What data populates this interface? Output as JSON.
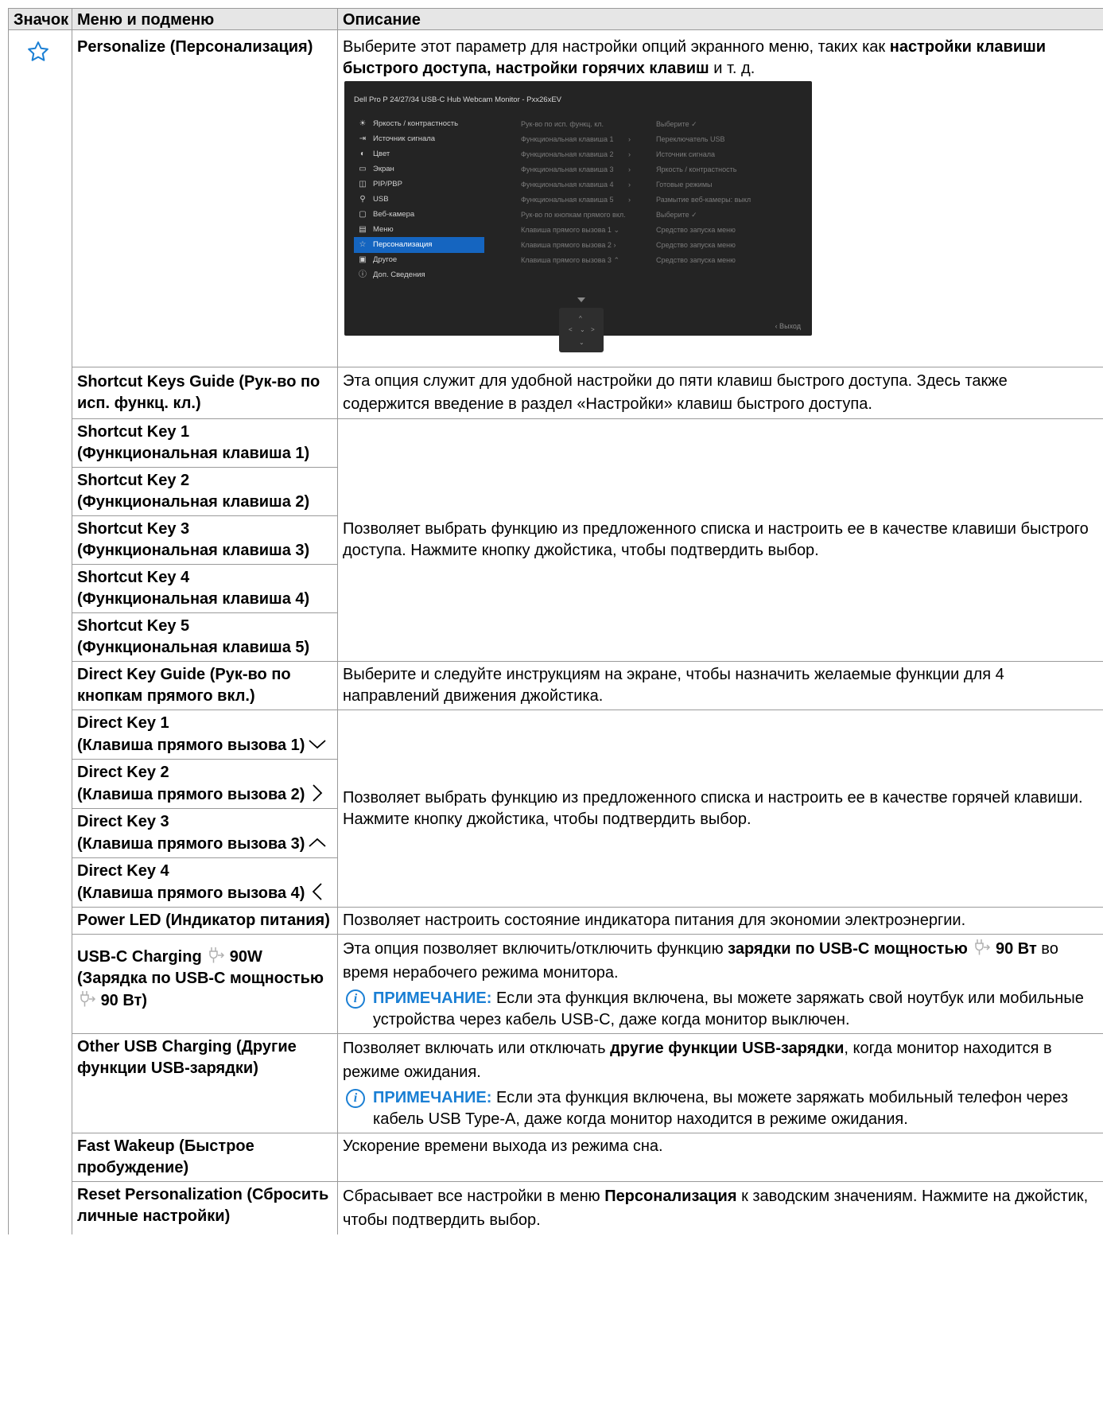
{
  "header": {
    "col_icon": "Значок",
    "col_menu": "Меню и подменю",
    "col_desc": "Описание"
  },
  "personalize": {
    "menu": "Personalize (Персонализация)",
    "desc_pre": "Выберите этот параметр для настройки опций экранного меню, таких как ",
    "desc_bold": "настройки клавиши быстрого доступа, настройки горячих клавиш",
    "desc_post": " и т. д."
  },
  "osd": {
    "title": "Dell Pro P 24/27/34 USB-C Hub Webcam Monitor - Pxx26xEV",
    "items": [
      {
        "icon": "☀",
        "label": "Яркость / контрастность"
      },
      {
        "icon": "⇥",
        "label": "Источник сигнала"
      },
      {
        "icon": "◐",
        "label": "Цвет"
      },
      {
        "icon": "▭",
        "label": "Экран"
      },
      {
        "icon": "◫",
        "label": "PIP/PBP"
      },
      {
        "icon": "⚲",
        "label": "USB"
      },
      {
        "icon": "▢",
        "label": "Веб-камера"
      },
      {
        "icon": "▤",
        "label": "Меню"
      },
      {
        "icon": "☆",
        "label": "Персонализация"
      },
      {
        "icon": "▣",
        "label": "Другое"
      },
      {
        "icon": "ⓘ",
        "label": "Доп. Сведения"
      }
    ],
    "mid": [
      "Рук-во по исп. функц. кл.",
      "Функциональная клавиша 1",
      "Функциональная клавиша 2",
      "Функциональная клавиша 3",
      "Функциональная клавиша 4",
      "Функциональная клавиша 5",
      "Рук-во по кнопкам прямого вкл.",
      "Клавиша прямого вызова 1 ⌄",
      "Клавиша прямого вызова 2 ›",
      "Клавиша прямого вызова 3 ⌃"
    ],
    "right": [
      "Выберите ✓",
      "Переключатель USB",
      "Источник сигнала",
      "Яркость / контрастность",
      "Готовые режимы",
      "Размытие веб-камеры: выкл",
      "Выберите ✓",
      "Средство запуска меню",
      "Средство запуска меню",
      "Средство запуска меню"
    ],
    "exit": "‹ Выход"
  },
  "rows": {
    "skg_menu": "Shortcut Keys Guide (Рук-во по исп. функц. кл.)",
    "skg_desc": "Эта опция служит для удобной настройки до пяти клавиш быстрого доступа. Здесь также содержится введение в раздел «Настройки» клавиш быстрого доступа.",
    "sk1": "Shortcut Key 1 (Функциональная клавиша 1)",
    "sk2": "Shortcut Key 2 (Функциональная клавиша 2)",
    "sk3": "Shortcut Key 3 (Функциональная клавиша 3)",
    "sk4": "Shortcut Key 4 (Функциональная клавиша 4)",
    "sk5": "Shortcut Key 5 (Функциональная клавиша 5)",
    "sk_desc": "Позволяет выбрать функцию из предложенного списка и настроить ее в качестве клавиши быстрого доступа. Нажмите кнопку джойстика, чтобы подтвердить выбор.",
    "dkg_menu": "Direct Key Guide (Рук-во по кнопкам прямого вкл.)",
    "dkg_desc": "Выберите и следуйте инструкциям на экране, чтобы назначить желаемые функции для 4 направлений движения джойстика.",
    "dk1_a": "Direct Key 1",
    "dk1_b": "(Клавиша прямого вызова 1)",
    "dk2_a": "Direct Key 2",
    "dk2_b": "(Клавиша прямого вызова 2)",
    "dk3_a": "Direct Key 3",
    "dk3_b": "(Клавиша прямого вызова 3)",
    "dk4_a": "Direct Key 4",
    "dk4_b": "(Клавиша прямого вызова 4)",
    "dk_desc": "Позволяет выбрать функцию из предложенного списка и настроить ее в качестве горячей клавиши. Нажмите кнопку джойстика, чтобы подтвердить выбор.",
    "led_menu": "Power LED (Индикатор питания)",
    "led_desc": "Позволяет настроить состояние индикатора питания для экономии электроэнергии.",
    "usbc_menu_a": "USB-C Charging",
    "usbc_menu_b": "90W",
    "usbc_menu_c": "(Зарядка по USB-C мощностью",
    "usbc_menu_d": "90 Вт)",
    "usbc_desc_pre": "Эта опция позволяет включить/отключить функцию ",
    "usbc_desc_bold1": "зарядки по USB-C мощностью",
    "usbc_desc_bold2": "90 Вт",
    "usbc_desc_post": " во время нерабочего режима монитора.",
    "note_label": "ПРИМЕЧАНИЕ:",
    "usbc_note": "Если эта функция включена, вы можете заряжать свой ноутбук или мобильные устройства через кабель USB-C, даже когда монитор выключен.",
    "other_menu": "Other USB Charging (Другие функции USB-зарядки)",
    "other_desc_pre": "Позволяет включать или отключать ",
    "other_desc_bold": "другие функции USB-зарядки",
    "other_desc_post": ", когда монитор находится в режиме ожидания.",
    "other_note": "Если эта функция включена, вы можете заряжать мобильный телефон через кабель USB Type-A, даже когда монитор находится в режиме ожидания.",
    "fast_menu": "Fast Wakeup (Быстрое пробуждение)",
    "fast_desc": "Ускорение времени выхода из режима сна.",
    "reset_menu": "Reset Personalization (Сбросить личные настройки)",
    "reset_desc_pre": "Сбрасывает все настройки в меню ",
    "reset_desc_bold": "Персонализация",
    "reset_desc_post": " к заводским значениям. Нажмите на джойстик, чтобы подтвердить выбор."
  }
}
